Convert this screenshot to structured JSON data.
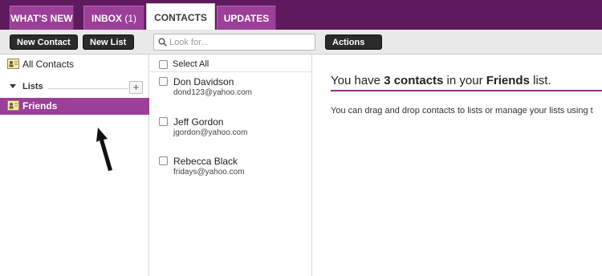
{
  "tabs": [
    {
      "label": "WHAT'S NEW"
    },
    {
      "label": "INBOX",
      "count": "(1)"
    },
    {
      "label": "CONTACTS",
      "active": true
    },
    {
      "label": "UPDATES"
    }
  ],
  "toolbar": {
    "new_contact_label": "New Contact",
    "new_list_label": "New List",
    "search_placeholder": "Look for...",
    "actions_label": "Actions"
  },
  "left": {
    "all_contacts_label": "All Contacts",
    "lists_header": "Lists",
    "add_label": "+",
    "lists": [
      {
        "label": "Friends"
      }
    ]
  },
  "middle": {
    "select_all_label": "Select All",
    "contacts": [
      {
        "name": "Don Davidson",
        "email": "dond123@yahoo.com"
      },
      {
        "name": "Jeff Gordon",
        "email": "jgordon@yahoo.com"
      },
      {
        "name": "Rebecca Black",
        "email": "fridays@yahoo.com"
      }
    ]
  },
  "right": {
    "headline_pre": "You have ",
    "headline_count": "3 contacts",
    "headline_mid": " in your ",
    "headline_list": "Friends",
    "headline_post": " list.",
    "info": "You can drag and drop contacts to lists or manage your lists using t"
  },
  "colors": {
    "brand_dark": "#5e1a5c",
    "brand": "#9b3f98",
    "button": "#2b2b2b"
  }
}
